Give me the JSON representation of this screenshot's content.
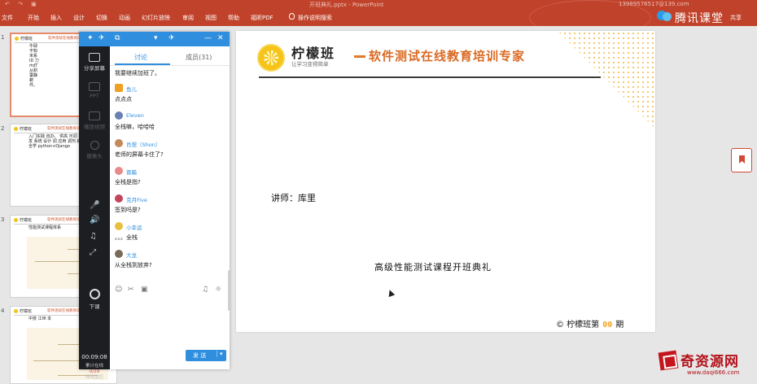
{
  "titlebar": {
    "doc_title": "开班典礼.pptx - PowerPoint",
    "user": "13989576517@139.com",
    "quick_access": "↶ ↷ ▣"
  },
  "ribbon": {
    "tabs": [
      "文件",
      "开始",
      "插入",
      "设计",
      "切换",
      "动画",
      "幻灯片放映",
      "审阅",
      "视图",
      "帮助",
      "福昕PDF"
    ],
    "search": "操作说明搜索",
    "share": "共享"
  },
  "brand_logo": {
    "name": "腾讯课堂"
  },
  "thumbnails": [
    {
      "num": "1",
      "text": "牛碌 不知 米系 ID 力 rtdT 从耐 蚕静 耙 件。",
      "active": true
    },
    {
      "num": "2",
      "text": "入门实践 自办、 供高 可调 PWP 开发 系统 设计 调 应用 调剂 脚、 安全学 python+Django",
      "active": false
    },
    {
      "num": "3",
      "text": "性能测试课程体系",
      "active": false
    },
    {
      "num": "4",
      "text": "中技 江世 本",
      "active": false
    }
  ],
  "chat": {
    "topbar_icons": [
      "✦",
      "✈",
      "⧉",
      "▾",
      "✈",
      "—",
      "✕"
    ],
    "rail": [
      {
        "label": "分享屏幕",
        "enabled": true
      },
      {
        "label": "PPT",
        "enabled": false
      },
      {
        "label": "播放视频",
        "enabled": false
      },
      {
        "label": "摄像头",
        "enabled": false
      }
    ],
    "rail_icons": [
      "🎤",
      "🔊",
      "♫",
      "⤢"
    ],
    "end_label": "下课",
    "timer": "00:09:08",
    "info_label": "累计在线",
    "info_count": "0/29",
    "network": "网络监控",
    "tabs": {
      "discussion": "讨论",
      "members": "成员(31)"
    },
    "messages": [
      {
        "name": "",
        "text": "我要继续加班了。",
        "avatar_color": ""
      },
      {
        "name": "鱼儿",
        "text": "点点点",
        "avatar_color": "#f0a020"
      },
      {
        "name": "Eleven",
        "text": "全栈嘛，哈哈哈",
        "avatar_color": "#6a7fb3"
      },
      {
        "name": "肖想（Shon）",
        "text": "老师的屏幕卡住了?",
        "avatar_color": "#c28a5a"
      },
      {
        "name": "晋黯",
        "text": "全栈是指?",
        "avatar_color": "#e88a8a"
      },
      {
        "name": "克月Five",
        "text": "签到吗是?",
        "avatar_color": "#c4445a"
      },
      {
        "name": "小幸运",
        "text": "。。。全栈",
        "avatar_color": "#e8c040"
      },
      {
        "name": "大龙",
        "text": "从全栈到放弃?",
        "avatar_color": "#7a6a5a"
      }
    ],
    "tool_icons": [
      "☺",
      "✂",
      "▣",
      "♫",
      "☼"
    ],
    "send_label": "发 送"
  },
  "slide": {
    "brand": "柠檬班",
    "slogan": "让学习变得简单",
    "headline": "软件测试在线教育培训专家",
    "teacher": "讲师：库里",
    "course": "高级性能测试课程开班典礼",
    "footer_prefix": "© 柠檬班第",
    "footer_num": "00",
    "footer_suffix": "期"
  },
  "watermark": {
    "title": "奇资源网",
    "url": "www.daqi666.com"
  }
}
